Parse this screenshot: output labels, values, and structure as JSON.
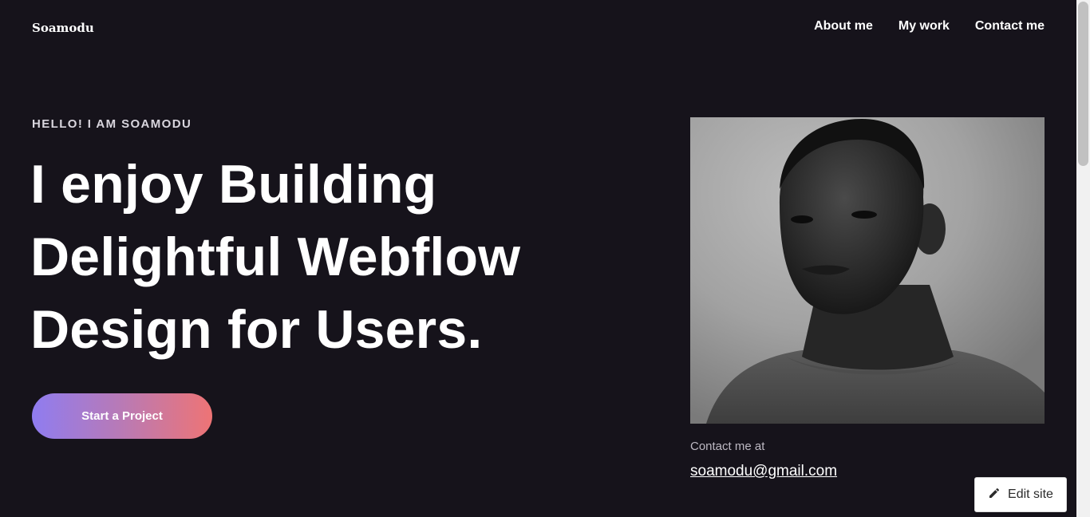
{
  "header": {
    "logo": "Soamodu",
    "nav": [
      {
        "label": "About me"
      },
      {
        "label": "My work"
      },
      {
        "label": "Contact me"
      }
    ]
  },
  "hero": {
    "eyebrow": "HELLO! I AM SOAMODU",
    "headline_lines": [
      "I enjoy Building",
      "Delightful Webflow",
      "Design for Users."
    ],
    "cta_label": "Start a Project",
    "cta_gradient": [
      "#8f7cf0",
      "#ee7475"
    ]
  },
  "contact": {
    "label": "Contact me at",
    "email": "soamodu@gmail.com"
  },
  "edit_site": {
    "label": "Edit site",
    "icon": "pencil-icon"
  },
  "theme": {
    "background": "#16131b",
    "text": "#ffffff"
  }
}
